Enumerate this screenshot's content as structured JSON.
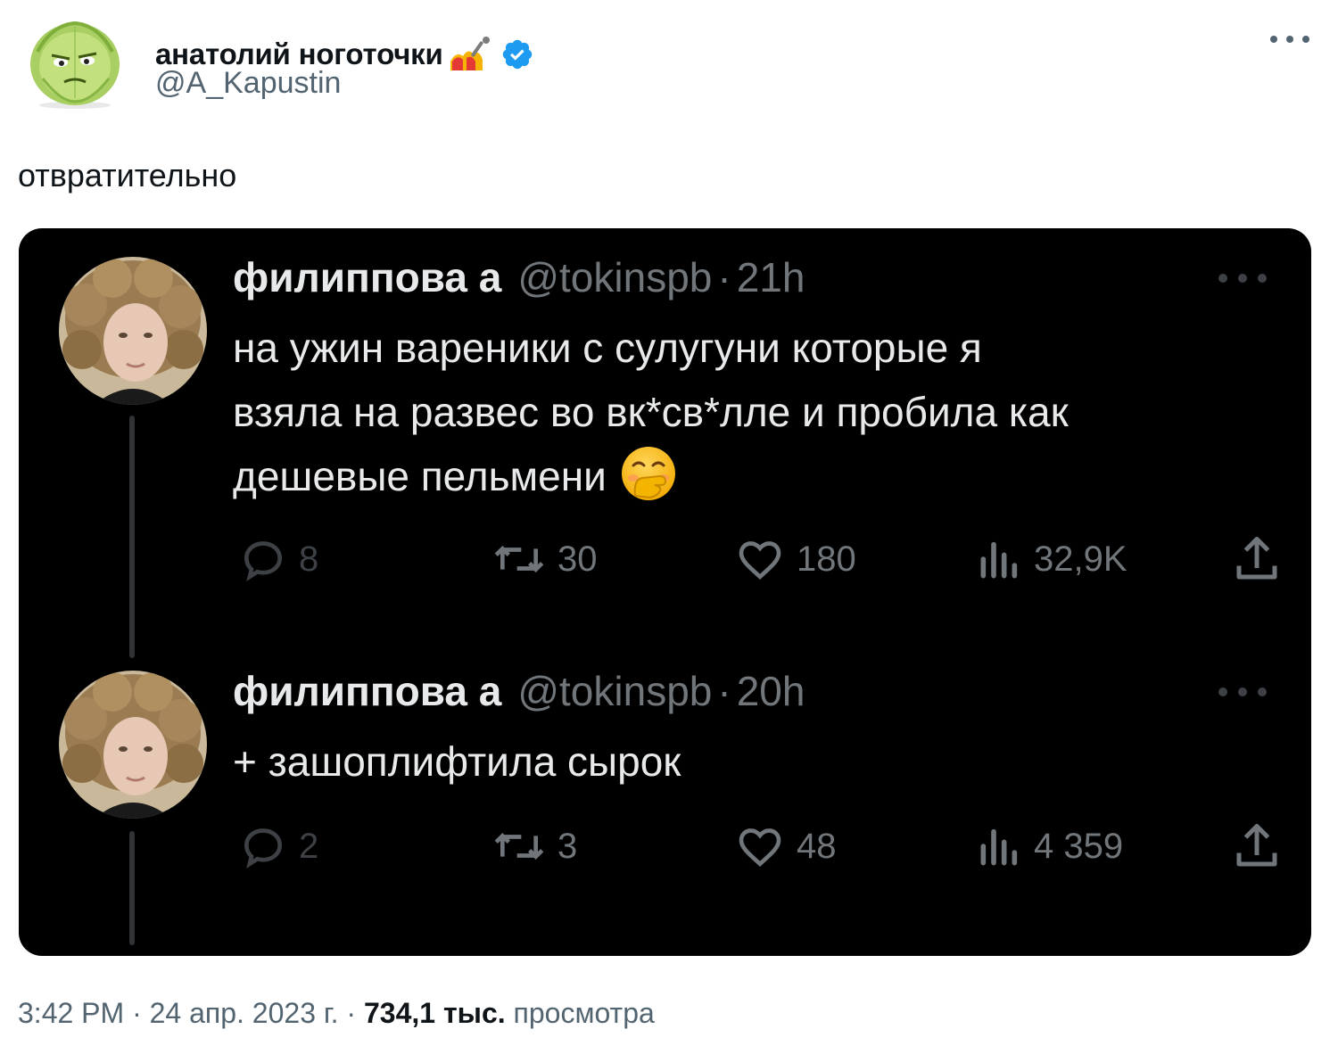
{
  "author": {
    "display_name": "анатолий ноготочки",
    "handle": "@A_Kapustin"
  },
  "tweet": {
    "text": "отвратительно",
    "footer": {
      "time": "3:42 PM",
      "separator": "·",
      "date": "24 апр. 2023 г.",
      "views_count": "734,1 тыс.",
      "views_label": "просмотра"
    }
  },
  "screenshot": {
    "posts": [
      {
        "name": "филиппова а",
        "handle": "@tokinspb",
        "separator": "·",
        "time": "21h",
        "lines": [
          "на ужин вареники с сулугуни которые я",
          "взяла на развес во вк*св*лле и пробила как",
          "дешевые пельмени"
        ],
        "emoji": "face-with-hand-over-mouth",
        "stats": {
          "replies": "8",
          "reposts": "30",
          "likes": "180",
          "views": "32,9K"
        }
      },
      {
        "name": "филиппова а",
        "handle": "@tokinspb",
        "separator": "·",
        "time": "20h",
        "lines": [
          "+ зашоплифтила сырок"
        ],
        "stats": {
          "replies": "2",
          "reposts": "3",
          "likes": "48",
          "views": "4 359"
        }
      }
    ]
  },
  "colors": {
    "verified": "#1d9bf0",
    "dark_bg": "#000000",
    "dark_text": "#e7e9ea",
    "dark_muted": "#71767b",
    "light_muted": "#536471"
  }
}
